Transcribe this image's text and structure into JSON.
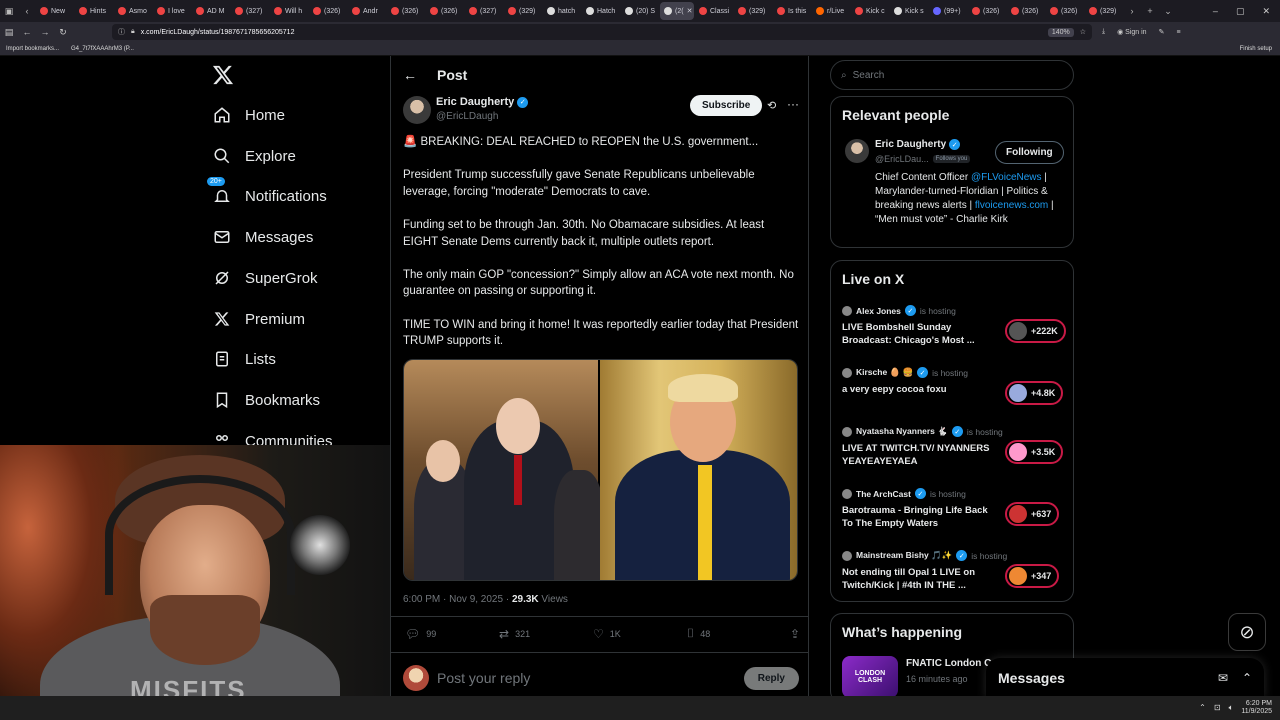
{
  "browser": {
    "tabs": [
      {
        "label": "New",
        "color": "#e44"
      },
      {
        "label": "Hints",
        "color": "#e44"
      },
      {
        "label": "Asmo",
        "color": "#e44"
      },
      {
        "label": "I love",
        "color": "#e44"
      },
      {
        "label": "AD M",
        "color": "#e44"
      },
      {
        "label": "(327)",
        "color": "#e44"
      },
      {
        "label": "Will h",
        "color": "#e44"
      },
      {
        "label": "(326)",
        "color": "#e44"
      },
      {
        "label": "Andr",
        "color": "#e44"
      },
      {
        "label": "(326)",
        "color": "#e44"
      },
      {
        "label": "(326)",
        "color": "#e44"
      },
      {
        "label": "(327)",
        "color": "#e44"
      },
      {
        "label": "(329)",
        "color": "#e44"
      },
      {
        "label": "hatch",
        "color": "#ddd"
      },
      {
        "label": "Hatch",
        "color": "#ddd"
      },
      {
        "label": "(20) S",
        "color": "#ddd"
      },
      {
        "label": "(2(",
        "color": "#ddd",
        "active": true
      },
      {
        "label": "Classi",
        "color": "#e44"
      },
      {
        "label": "(329)",
        "color": "#e44"
      },
      {
        "label": "Is this",
        "color": "#e44"
      },
      {
        "label": "r/Live",
        "color": "#f60"
      },
      {
        "label": "Kick c",
        "color": "#e44"
      },
      {
        "label": "Kick s",
        "color": "#ddd"
      },
      {
        "label": "(99+)",
        "color": "#66f"
      },
      {
        "label": "(326)",
        "color": "#e44"
      },
      {
        "label": "(326)",
        "color": "#e44"
      },
      {
        "label": "(326)",
        "color": "#e44"
      },
      {
        "label": "(329)",
        "color": "#e44"
      }
    ],
    "url": "x.com/EricLDaugh/status/1987671785656205712",
    "zoom": "140%",
    "sign_in": "Sign in",
    "bookmarks": [
      "Import bookmarks...",
      "G4_7t7fXAAAhrM3 (P..."
    ],
    "finish_setup": "Finish setup"
  },
  "nav": {
    "items": [
      {
        "label": "Home",
        "icon": "home-icon"
      },
      {
        "label": "Explore",
        "icon": "search-icon"
      },
      {
        "label": "Notifications",
        "icon": "bell-icon",
        "badge": "20+"
      },
      {
        "label": "Messages",
        "icon": "mail-icon"
      },
      {
        "label": "SuperGrok",
        "icon": "grok-icon"
      },
      {
        "label": "Premium",
        "icon": "x-icon"
      },
      {
        "label": "Lists",
        "icon": "list-icon"
      },
      {
        "label": "Bookmarks",
        "icon": "bookmark-icon"
      },
      {
        "label": "Communities",
        "icon": "people-icon"
      }
    ]
  },
  "post": {
    "header": "Post",
    "author_name": "Eric Daugherty",
    "author_handle": "@EricLDaugh",
    "subscribe": "Subscribe",
    "paragraphs": [
      "🚨 BREAKING: DEAL REACHED to REOPEN the U.S. government...",
      "President Trump successfully gave Senate Republicans unbelievable leverage, forcing \"moderate\" Democrats to cave.",
      "Funding set to be through Jan. 30th. No Obamacare subsidies. At least EIGHT Senate Dems currently back it, multiple outlets report.",
      "The only main GOP \"concession?\" Simply allow an ACA vote next month. No guarantee on passing or supporting it.",
      "TIME TO WIN and bring it home! It was reportedly earlier today that President TRUMP supports it."
    ],
    "timestamp": "6:00 PM · Nov 9, 2025 · ",
    "views_count": "29.3K",
    "views_label": " Views",
    "replies": "99",
    "reposts": "321",
    "likes": "1K",
    "bookmarks": "48",
    "reply_placeholder": "Post your reply",
    "reply_button": "Reply"
  },
  "sidebar": {
    "search_placeholder": "Search",
    "relevant_title": "Relevant people",
    "person": {
      "name": "Eric Daugherty",
      "handle": "@EricLDau...",
      "follows_you": "Follows you",
      "button": "Following",
      "bio_1": "Chief Content Officer ",
      "bio_link_1": "@FLVoiceNews",
      "bio_2": " | Marylander-turned-Floridian | Politics & breaking news alerts | ",
      "bio_link_2": "flvoicenews.com",
      "bio_3": " | “Men must vote” - Charlie Kirk"
    },
    "live_title": "Live on X",
    "live": [
      {
        "host": "Alex Jones",
        "hosting": "is hosting",
        "title": "LIVE Bombshell Sunday Broadcast: Chicago's Most ...",
        "count": "+222K",
        "color": "#555"
      },
      {
        "host": "Kirsche 🥚 🍔",
        "hosting": "is hosting",
        "title": "a very eepy cocoa foxu",
        "count": "+4.8K",
        "color": "#9ad"
      },
      {
        "host": "Nyatasha Nyanners 🐇",
        "hosting": "is hosting",
        "title": "LIVE AT TWITCH.TV/ NYANNERS YEAYEAYEYAEA",
        "count": "+3.5K",
        "color": "#f9c"
      },
      {
        "host": "The ArchCast",
        "hosting": "is hosting",
        "title": "Barotrauma - Bringing Life Back To The Empty Waters",
        "count": "+637",
        "color": "#c33"
      },
      {
        "host": "Mainstream Bishy 🎵✨",
        "hosting": "is hosting",
        "title": "Not ending till Opal 1 LIVE on Twitch/Kick | #4th IN THE ...",
        "count": "+347",
        "color": "#e83"
      }
    ],
    "happening_title": "What’s happening",
    "trend_thumb": "LONDON CLASH",
    "trend_title": "FNATIC London C...",
    "trend_time": "16 minutes ago"
  },
  "messages_drawer": "Messages",
  "webcam": {
    "shirt_text": "MISFITS"
  },
  "taskbar": {
    "time": "6:20 PM",
    "date": "11/9/2025"
  }
}
